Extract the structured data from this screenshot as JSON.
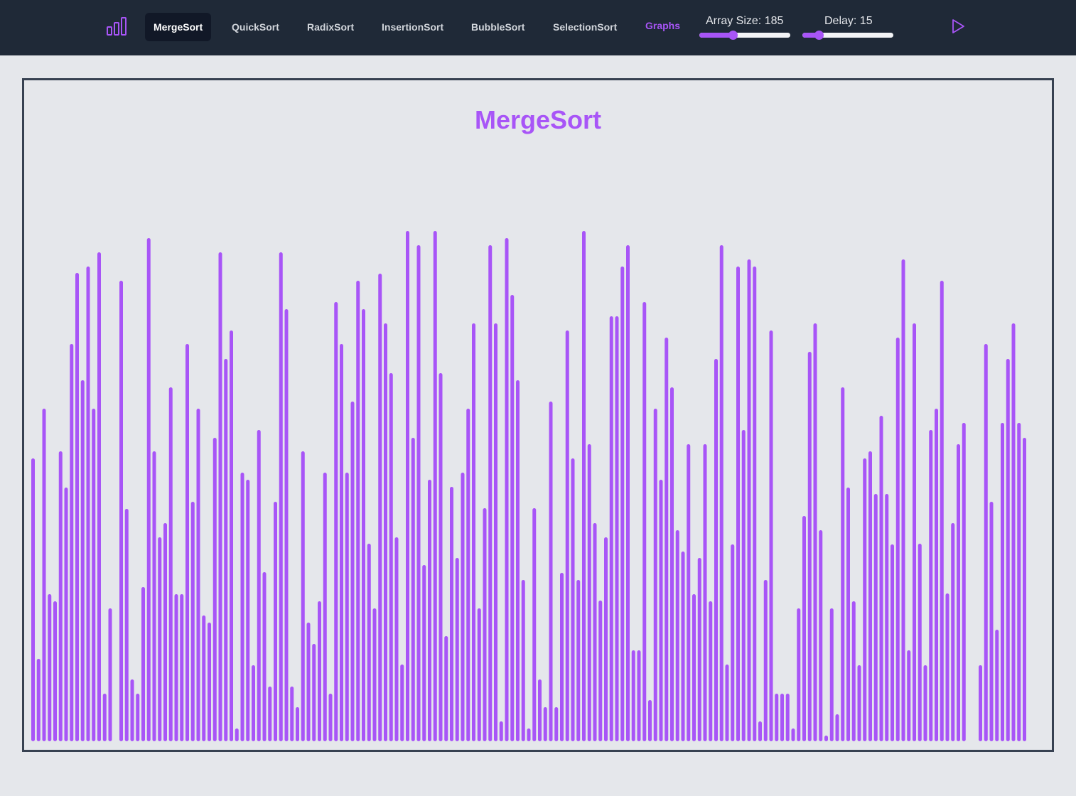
{
  "colors": {
    "accent": "#a855f7",
    "navbar": "#1f2937",
    "background": "#e5e7eb",
    "active_tab": "#111827",
    "panel_border": "#374151"
  },
  "logo_icon": "bar-chart-icon",
  "nav": {
    "tabs": [
      {
        "label": "MergeSort",
        "active": true
      },
      {
        "label": "QuickSort",
        "active": false
      },
      {
        "label": "RadixSort",
        "active": false
      },
      {
        "label": "InsertionSort",
        "active": false
      },
      {
        "label": "BubbleSort",
        "active": false
      },
      {
        "label": "SelectionSort",
        "active": false
      }
    ],
    "graphs_label": "Graphs",
    "array_size_label": "Array Size: 185",
    "array_size_level": 0.37,
    "delay_label": "Delay: 15",
    "delay_level": 0.18,
    "play_icon": "play-icon"
  },
  "visualizer": {
    "title": "MergeSort"
  },
  "chart_data": {
    "type": "bar",
    "title": "MergeSort",
    "xlabel": "",
    "ylabel": "",
    "ylim": [
      0,
      650
    ],
    "values": [
      398,
      116,
      468,
      207,
      197,
      408,
      357,
      559,
      659,
      508,
      668,
      468,
      688,
      67,
      187,
      0,
      648,
      327,
      87,
      67,
      217,
      708,
      408,
      287,
      307,
      498,
      207,
      207,
      559,
      337,
      468,
      177,
      167,
      427,
      688,
      538,
      578,
      18,
      378,
      368,
      107,
      438,
      238,
      77,
      337,
      688,
      608,
      77,
      48,
      408,
      167,
      137,
      197,
      378,
      67,
      618,
      559,
      378,
      478,
      648,
      608,
      278,
      187,
      658,
      588,
      518,
      287,
      108,
      718,
      427,
      698,
      248,
      368,
      718,
      518,
      148,
      358,
      258,
      378,
      468,
      588,
      187,
      328,
      698,
      588,
      28,
      708,
      628,
      508,
      227,
      18,
      328,
      87,
      48,
      478,
      48,
      237,
      578,
      398,
      227,
      718,
      418,
      307,
      198,
      287,
      598,
      598,
      668,
      698,
      128,
      128,
      618,
      58,
      468,
      368,
      568,
      498,
      297,
      267,
      418,
      207,
      258,
      418,
      197,
      538,
      698,
      108,
      277,
      668,
      438,
      678,
      668,
      28,
      227,
      578,
      67,
      67,
      67,
      18,
      187,
      317,
      548,
      588,
      297,
      8,
      187,
      38,
      498,
      357,
      197,
      107,
      398,
      408,
      348,
      458,
      348,
      277,
      568,
      678,
      128,
      588,
      278,
      107,
      438,
      468,
      648,
      208,
      307,
      418,
      448,
      0,
      0,
      107,
      559,
      337,
      157,
      448,
      538,
      588,
      448,
      427
    ],
    "bar_count": 185
  }
}
